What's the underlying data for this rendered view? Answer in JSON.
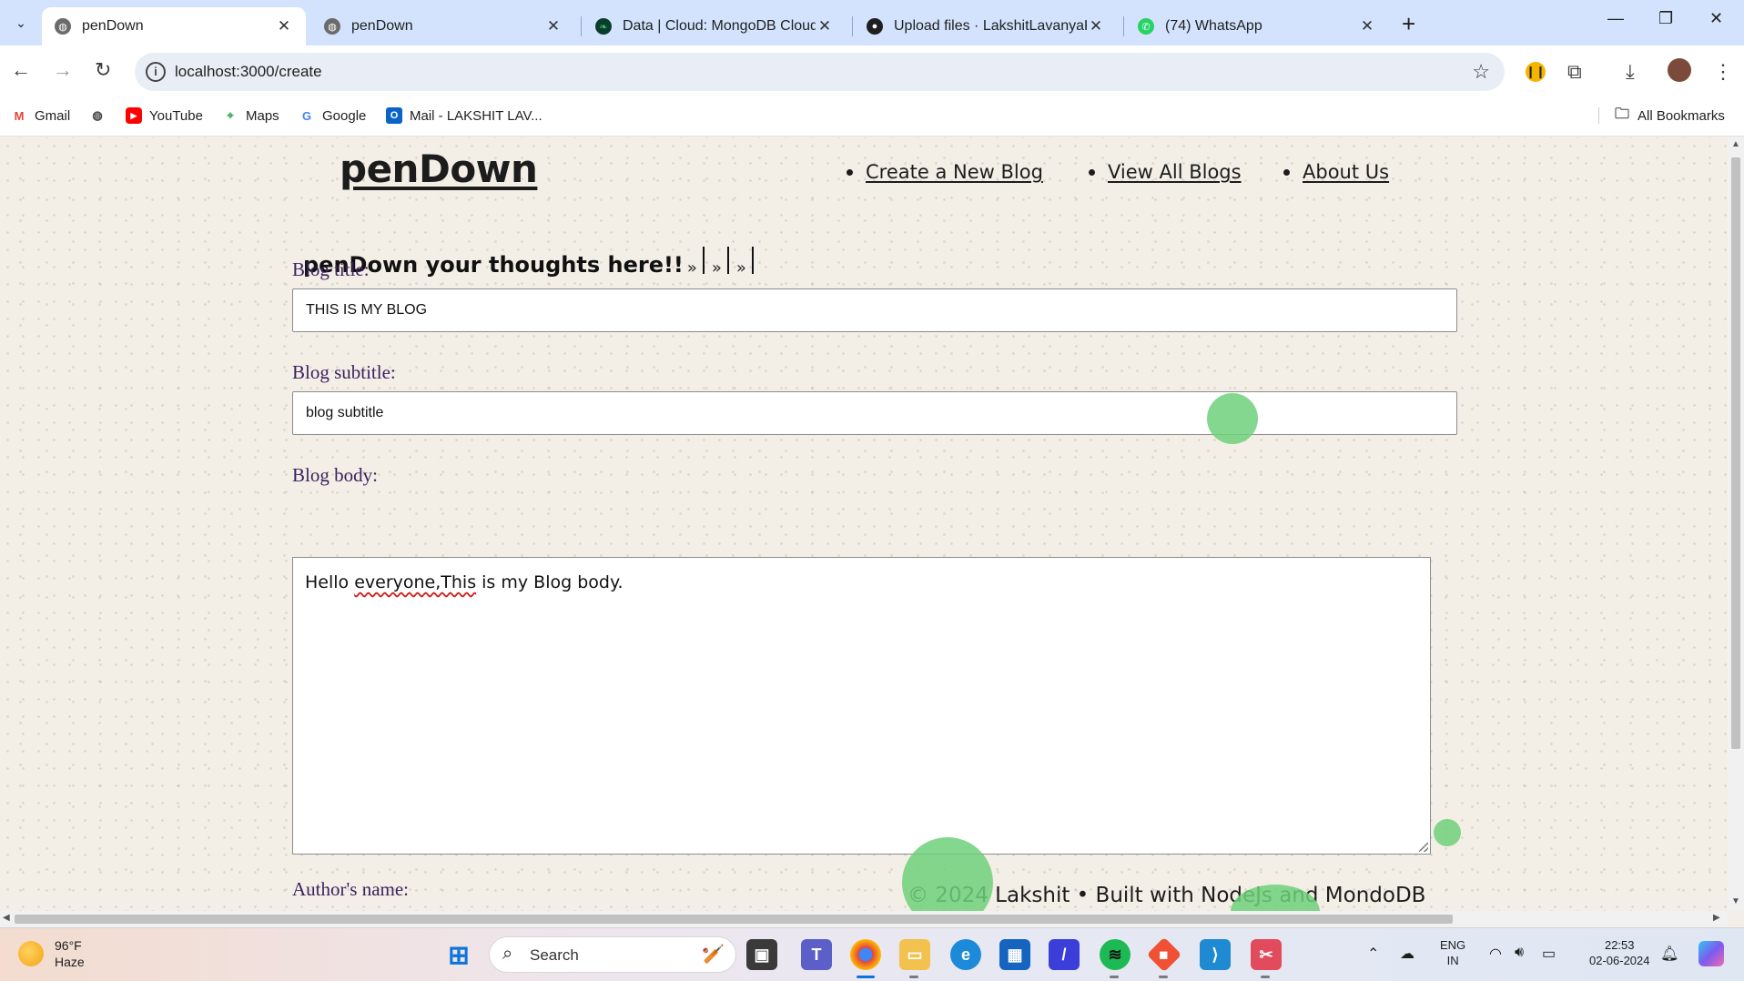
{
  "browser": {
    "tabs": [
      {
        "title": "penDown",
        "active": true
      },
      {
        "title": "penDown",
        "active": false
      },
      {
        "title": "Data | Cloud: MongoDB Cloud",
        "active": false
      },
      {
        "title": "Upload files · LakshitLavanyaKu",
        "active": false
      },
      {
        "title": "(74) WhatsApp",
        "active": false
      }
    ],
    "url": "localhost:3000/create",
    "bookmarks": [
      {
        "label": "Gmail",
        "icon": "gmail-icon"
      },
      {
        "label": "",
        "icon": "globe-icon"
      },
      {
        "label": "YouTube",
        "icon": "youtube-icon"
      },
      {
        "label": "Maps",
        "icon": "maps-icon"
      },
      {
        "label": "Google",
        "icon": "google-icon"
      },
      {
        "label": "Mail - LAKSHIT LAV...",
        "icon": "outlook-icon"
      }
    ],
    "all_bookmarks": "All Bookmarks"
  },
  "page": {
    "logo": "penDown",
    "nav": [
      "Create a New Blog",
      "View All Blogs",
      "About Us"
    ],
    "tagline": "penDown your thoughts here!!",
    "chevron": "»",
    "form": {
      "title_label": "Blog title:",
      "title_value": "THIS IS MY BLOG",
      "subtitle_label": "Blog subtitle:",
      "subtitle_value": "blog subtitle",
      "body_label": "Blog body:",
      "body_value_a": "Hello ",
      "body_value_misspelled": "everyone,This",
      "body_value_b": " is my Blog body.",
      "author_label": "Author's name:"
    },
    "footer": "© 2024 Lakshit • Built with NodeJs and MondoDB"
  },
  "taskbar": {
    "weather_temp": "96°F",
    "weather_desc": "Haze",
    "search_label": "Search",
    "lang_top": "ENG",
    "lang_bottom": "IN",
    "time": "22:53",
    "date": "02-06-2024"
  },
  "colors": {
    "accent_label": "#3a1f5e",
    "bubble": "#6fd07a",
    "tab_bar": "#d3e3fd"
  }
}
